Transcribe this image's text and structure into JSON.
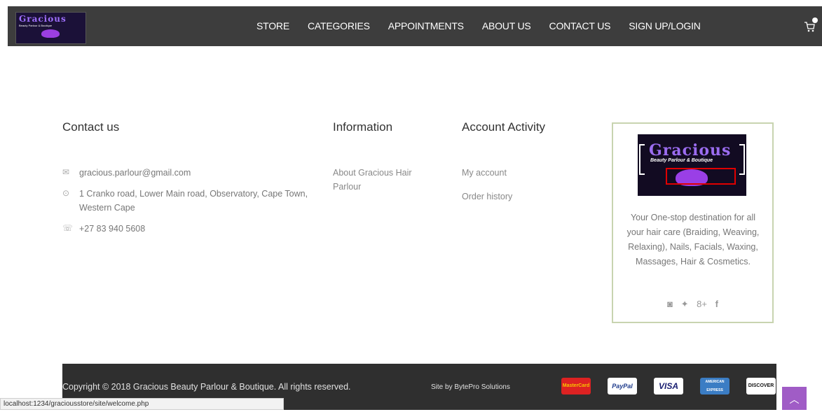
{
  "navbar": {
    "logo_word": "Gracious",
    "logo_tag": "Beauty Parlour & Boutique",
    "items": [
      "STORE",
      "CATEGORIES",
      "APPOINTMENTS",
      "ABOUT US",
      "CONTACT US",
      "SIGN UP/LOGIN"
    ]
  },
  "contact": {
    "heading": "Contact us",
    "email": "gracious.parlour@gmail.com",
    "address": "1 Cranko road, Lower Main road, Observatory, Cape Town, Western Cape",
    "phone": "+27 83 940 5608"
  },
  "information": {
    "heading": "Information",
    "links": [
      "About Gracious Hair Parlour"
    ]
  },
  "account": {
    "heading": "Account Activity",
    "links": [
      "My account",
      "Order history"
    ]
  },
  "brand": {
    "logo_word": "Gracious",
    "logo_tag": "Beauty Parlour & Boutique",
    "description": "Your One-stop destination for all your hair care (Braiding, Weaving, Relaxing), Nails, Facials, Waxing, Massages, Hair & Cosmetics."
  },
  "footer": {
    "copyright": "Copyright © 2018 Gracious Beauty Parlour & Boutique. All rights reserved.",
    "siteby": "Site by BytePro Solutions",
    "payments": [
      "MasterCard",
      "PayPal",
      "VISA",
      "AMERICAN EXPRESS",
      "DISCOVER"
    ]
  },
  "statusbar": {
    "url": "localhost:1234/graciousstore/site/welcome.php"
  },
  "colors": {
    "navbar_bg": "#3d3d3d",
    "footer_bg": "#2f2f2f",
    "accent_purple": "#a05cc6",
    "brand_border": "#c8d4b0"
  }
}
